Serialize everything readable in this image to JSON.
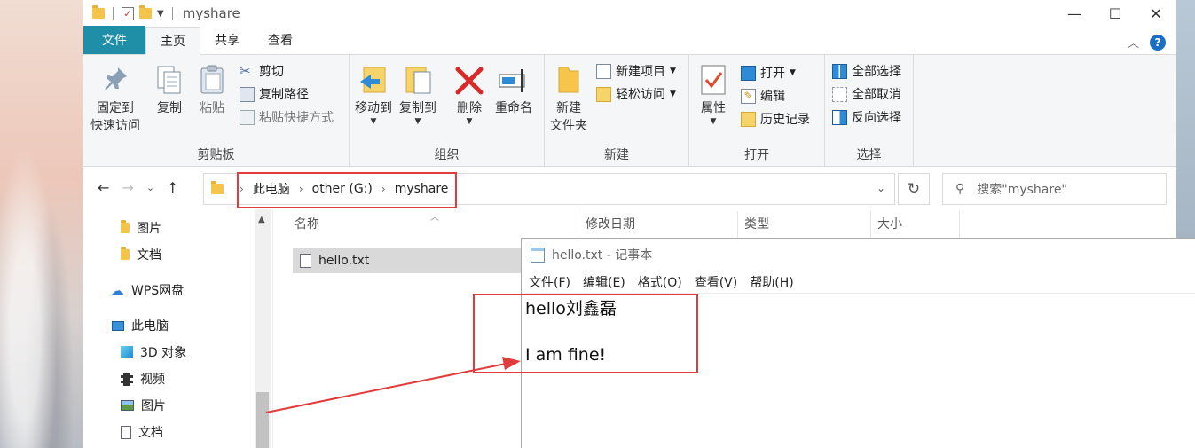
{
  "window": {
    "title": "myshare",
    "controls": {
      "minimize": "—",
      "maximize": "☐",
      "close": "✕"
    }
  },
  "tabs": [
    {
      "label": "文件"
    },
    {
      "label": "主页"
    },
    {
      "label": "共享"
    },
    {
      "label": "查看"
    }
  ],
  "ribbon": {
    "clipboard": {
      "pin_label_1": "固定到",
      "pin_label_2": "快速访问",
      "copy": "复制",
      "paste": "粘贴",
      "cut": "剪切",
      "copy_path": "复制路径",
      "paste_shortcut": "粘贴快捷方式",
      "group": "剪贴板"
    },
    "organize": {
      "move_to": "移动到",
      "copy_to": "复制到",
      "delete": "删除",
      "rename": "重命名",
      "group": "组织"
    },
    "new": {
      "new_folder_1": "新建",
      "new_folder_2": "文件夹",
      "new_item": "新建项目",
      "easy_access": "轻松访问",
      "group": "新建"
    },
    "open": {
      "properties": "属性",
      "open": "打开",
      "edit": "编辑",
      "history": "历史记录",
      "group": "打开"
    },
    "select": {
      "select_all": "全部选择",
      "select_none": "全部取消",
      "invert": "反向选择",
      "group": "选择"
    }
  },
  "address": {
    "crumbs": [
      "此电脑",
      "other (G:)",
      "myshare"
    ],
    "search_placeholder": "搜索\"myshare\""
  },
  "nav_pane": {
    "items": [
      "图片",
      "文档",
      "WPS网盘",
      "此电脑",
      "3D 对象",
      "视频",
      "图片",
      "文档"
    ]
  },
  "file_list": {
    "columns": [
      "名称",
      "修改日期",
      "类型",
      "大小"
    ],
    "files": [
      {
        "name": "hello.txt"
      }
    ]
  },
  "notepad": {
    "title": "hello.txt - 记事本",
    "menu": [
      "文件(F)",
      "编辑(E)",
      "格式(O)",
      "查看(V)",
      "帮助(H)"
    ],
    "lines": [
      "hello刘鑫磊",
      "",
      "I am fine!"
    ]
  },
  "colors": {
    "file_tab": "#1f8fa8",
    "highlight": "#e23b3b",
    "help": "#1b6ec2"
  }
}
